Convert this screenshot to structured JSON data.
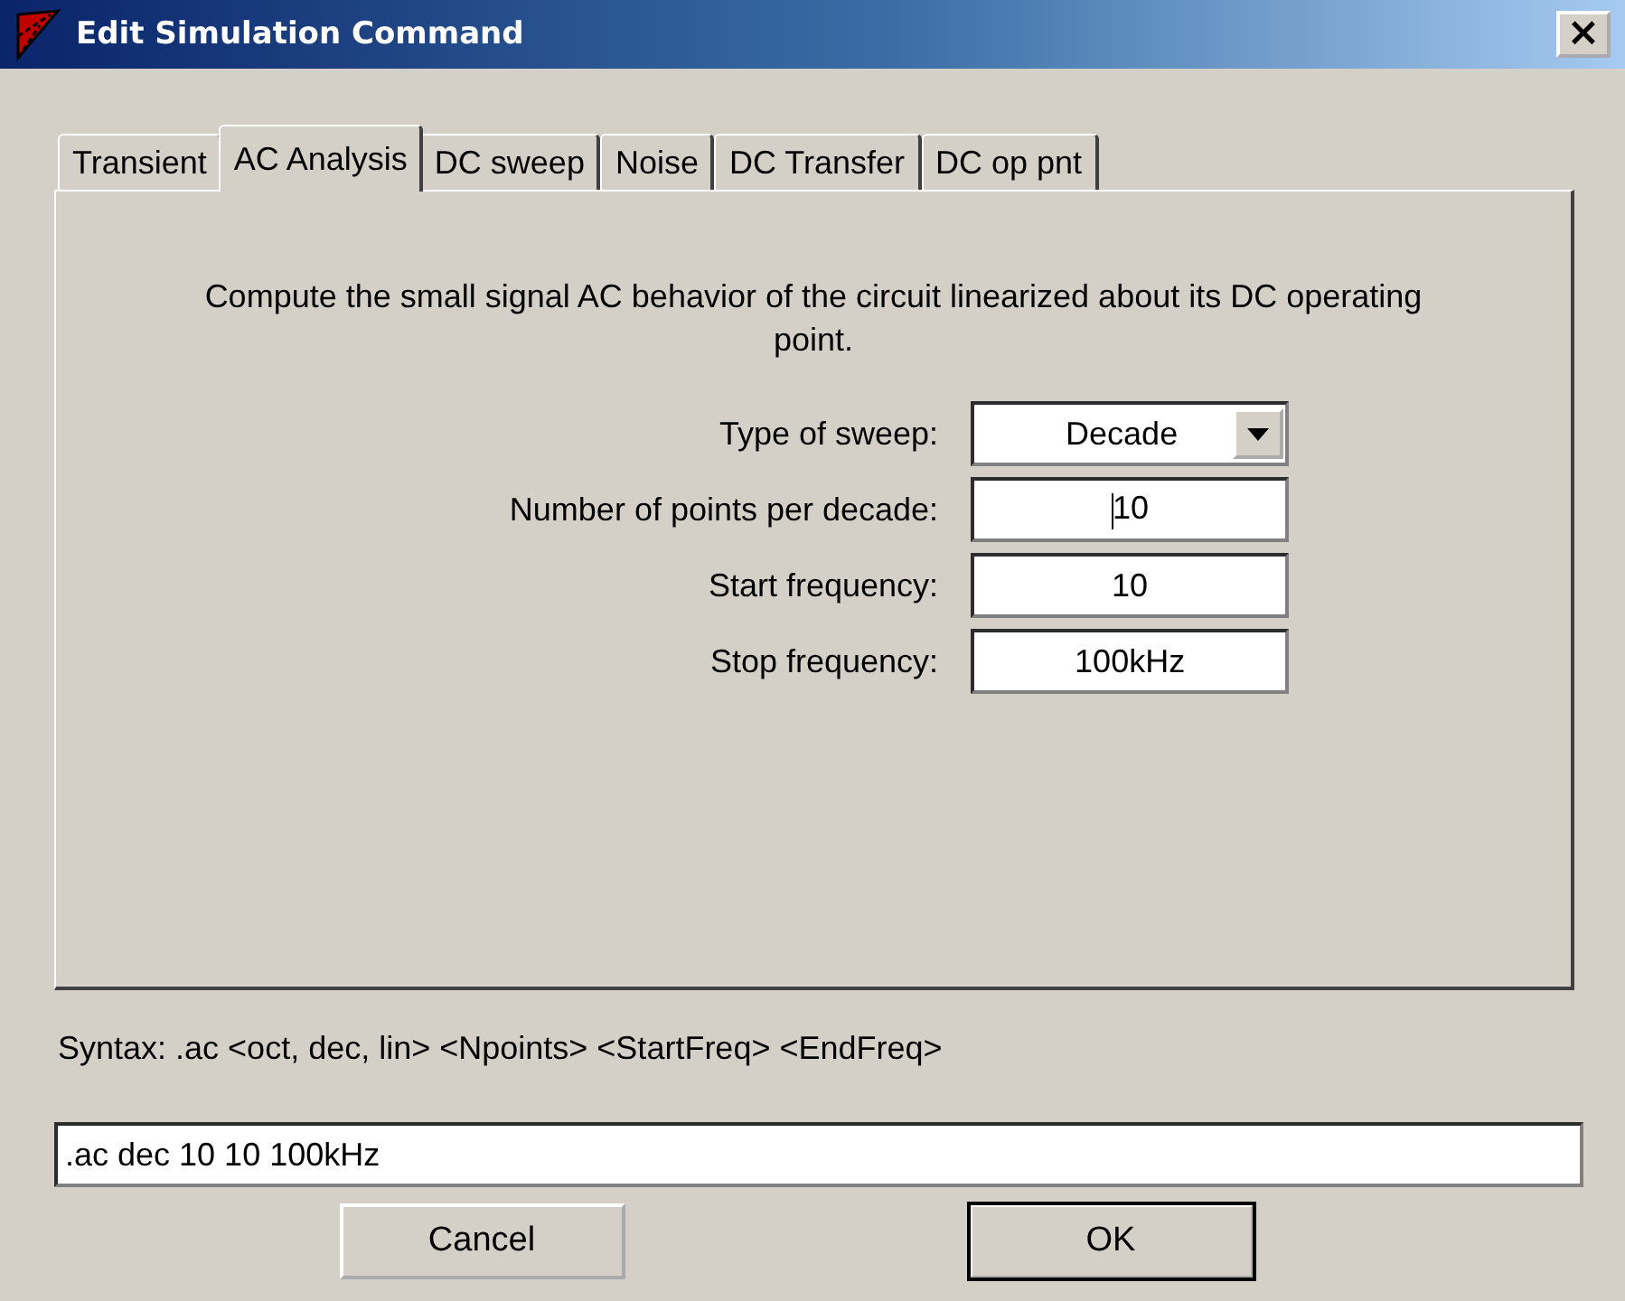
{
  "window": {
    "title": "Edit Simulation Command",
    "close": "×"
  },
  "tabs": [
    {
      "label": "Transient",
      "selected": false
    },
    {
      "label": "AC Analysis",
      "selected": true
    },
    {
      "label": "DC sweep",
      "selected": false
    },
    {
      "label": "Noise",
      "selected": false
    },
    {
      "label": "DC Transfer",
      "selected": false
    },
    {
      "label": "DC op pnt",
      "selected": false
    }
  ],
  "description": "Compute the small signal AC behavior of the circuit linearized about its DC operating point.",
  "fields": [
    {
      "kind": "dropdown",
      "label": "Type of sweep:",
      "value": "Decade"
    },
    {
      "kind": "text",
      "label": "Number of points per decade:",
      "value": "10",
      "focused": true
    },
    {
      "kind": "text",
      "label": "Start frequency:",
      "value": "10",
      "focused": false
    },
    {
      "kind": "text",
      "label": "Stop frequency:",
      "value": "100kHz",
      "focused": false
    }
  ],
  "syntax": "Syntax:  .ac <oct, dec, lin> <Npoints> <StartFreq> <EndFreq>",
  "command": ".ac dec 10 10 100kHz",
  "buttons": [
    {
      "label": "Cancel",
      "default": false
    },
    {
      "label": "OK",
      "default": true
    }
  ]
}
